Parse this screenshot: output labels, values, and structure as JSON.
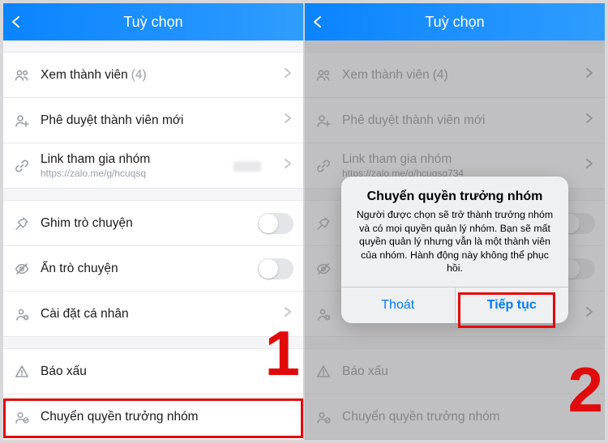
{
  "screens": {
    "left": {
      "header": {
        "title": "Tuỳ chọn"
      },
      "members": {
        "label": "Xem thành viên",
        "count": "(4)"
      },
      "approve": {
        "label": "Phê duyệt thành viên mới"
      },
      "link": {
        "label": "Link tham gia nhóm",
        "url": "https://zalo.me/g/hcuqsq"
      },
      "pin": {
        "label": "Ghim trò chuyện"
      },
      "hide": {
        "label": "Ẩn trò chuyện"
      },
      "personal": {
        "label": "Cài đặt cá nhân"
      },
      "report": {
        "label": "Báo xấu"
      },
      "transfer": {
        "label": "Chuyển quyền trưởng nhóm"
      },
      "step": "1"
    },
    "right": {
      "header": {
        "title": "Tuỳ chọn"
      },
      "members": {
        "label": "Xem thành viên",
        "count": "(4)"
      },
      "approve": {
        "label": "Phê duyệt thành viên mới"
      },
      "link": {
        "label": "Link tham gia nhóm",
        "url": "https://zalo.me/g/hcuqsq734"
      },
      "pin": {
        "label": "Ghim trò chuyện"
      },
      "hide": {
        "label": "Ẩn trò chuyện"
      },
      "personal": {
        "label": "Cài đặt cá nhân"
      },
      "report": {
        "label": "Báo xấu"
      },
      "transfer": {
        "label": "Chuyển quyền trưởng nhóm"
      },
      "dialog": {
        "title": "Chuyển quyền trưởng nhóm",
        "message": "Người được chọn sẽ trở thành trưởng nhóm và có mọi quyền quản lý nhóm. Bạn sẽ mất quyền quản lý nhưng vẫn là một thành viên của nhóm. Hành động này không thể phục hồi.",
        "cancel": "Thoát",
        "confirm": "Tiếp tục"
      },
      "step": "2"
    }
  },
  "icons": {
    "members": "members-icon",
    "approve": "add-user-icon",
    "link": "link-icon",
    "pin": "pin-icon",
    "hide": "hide-icon",
    "personal": "gear-user-icon",
    "report": "warning-icon",
    "transfer": "transfer-owner-icon"
  }
}
